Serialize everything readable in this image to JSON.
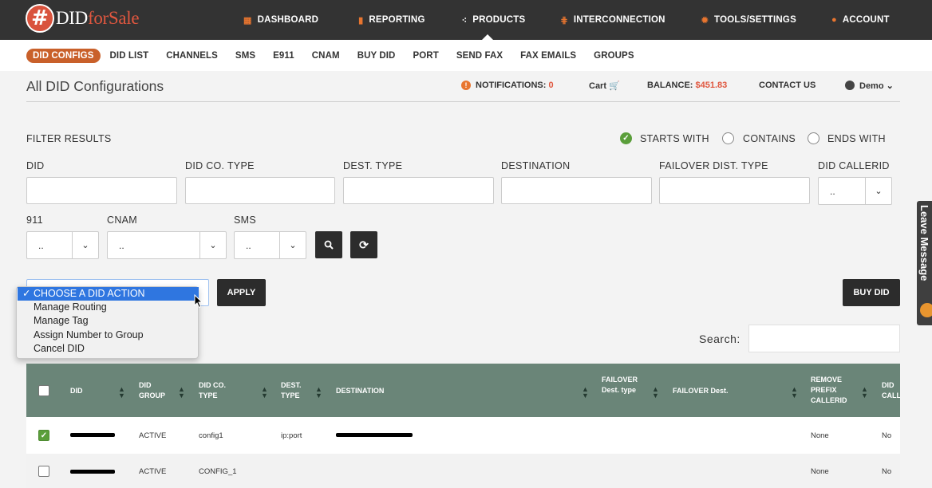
{
  "brand": {
    "part1": "DID",
    "part2": "forSale",
    "mark": "#"
  },
  "topnav": [
    {
      "label": "DASHBOARD",
      "icon": "▦"
    },
    {
      "label": "REPORTING",
      "icon": "▮"
    },
    {
      "label": "PRODUCTS",
      "icon": "⁖"
    },
    {
      "label": "INTERCONNECTION",
      "icon": "⋕"
    },
    {
      "label": "TOOLS/SETTINGS",
      "icon": "✹"
    },
    {
      "label": "ACCOUNT",
      "icon": "●"
    }
  ],
  "subnav": [
    "DID CONFIGS",
    "DID LIST",
    "CHANNELS",
    "SMS",
    "E911",
    "CNAM",
    "BUY DID",
    "PORT",
    "SEND FAX",
    "FAX EMAILS",
    "GROUPS"
  ],
  "page": {
    "title": "All DID Configurations"
  },
  "header": {
    "notifications_label": "NOTIFICATIONS:",
    "notifications_count": "0",
    "cart": "Cart",
    "balance_label": "BALANCE:",
    "balance_value": "$451.83",
    "contact": "CONTACT US",
    "user": "Demo"
  },
  "filter": {
    "title": "FILTER RESULTS",
    "modes": [
      "STARTS WITH",
      "CONTAINS",
      "ENDS WITH"
    ],
    "selected_mode": "STARTS WITH",
    "fields": [
      "DID",
      "DID CO. TYPE",
      "DEST. TYPE",
      "DESTINATION",
      "FAILOVER DIST. TYPE",
      "DID CALLERID"
    ],
    "callerid_value": "..",
    "row2": [
      {
        "label": "911",
        "value": ".."
      },
      {
        "label": "CNAM",
        "value": ".."
      },
      {
        "label": "SMS",
        "value": ".."
      }
    ]
  },
  "actions": {
    "dropdown_options": [
      "CHOOSE A DID ACTION",
      "Manage Routing",
      "Manage Tag",
      "Assign Number to Group",
      "Cancel DID"
    ],
    "selected": "CHOOSE A DID ACTION",
    "apply": "APPLY",
    "buy": "BUY DID"
  },
  "search": {
    "label": "Search:"
  },
  "table": {
    "columns": [
      "DID",
      "DID GROUP",
      "DID CO. TYPE",
      "DEST. TYPE",
      "DESTINATION",
      "FAILOVER Dest. type",
      "FAILOVER Dest.",
      "REMOVE PREFIX CALLERID",
      "DID CALL"
    ],
    "rows": [
      {
        "checked": true,
        "group": "ACTIVE",
        "type": "config1",
        "dest_type": "ip:port",
        "remove_prefix": "None",
        "callerid": "No"
      },
      {
        "checked": false,
        "group": "ACTIVE",
        "type": "CONFIG_1",
        "dest_type": "",
        "remove_prefix": "None",
        "callerid": "No"
      }
    ]
  },
  "sidetab": {
    "label": "Leave Message"
  },
  "colors": {
    "topbar": "#333333",
    "accent": "#c9602a",
    "table_header": "#6a8578",
    "check": "#5a9e3a",
    "balance": "#e0573f"
  }
}
